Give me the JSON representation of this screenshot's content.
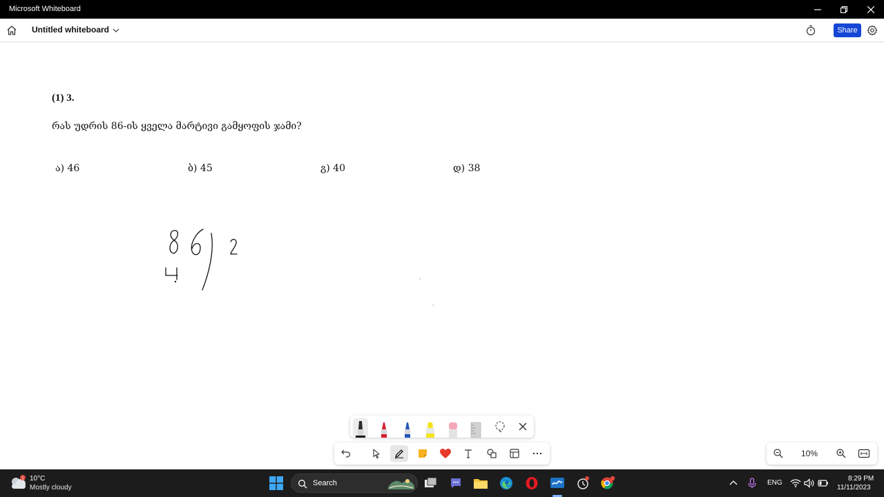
{
  "window": {
    "app_title": "Microsoft Whiteboard",
    "controls": [
      "minimize",
      "restore",
      "close"
    ]
  },
  "header": {
    "document_title": "Untitled whiteboard",
    "share_label": "Share",
    "icons": [
      "home-icon",
      "chevron-down-icon",
      "timer-icon",
      "gear-icon"
    ]
  },
  "canvas": {
    "question_number": "(1) 3.",
    "question_text": "რას უდრის 86-ის ყველა მარტივი გამყოფის ჯამი?",
    "options": [
      {
        "label": "ა) 46"
      },
      {
        "label": "ბ) 45"
      },
      {
        "label": "გ) 40"
      },
      {
        "label": "დ) 38"
      }
    ],
    "handwriting": "86 divided by 2, quotient starts with 4"
  },
  "pen_tray": {
    "pens": [
      {
        "name": "black-pen",
        "color": "#1a1a1a",
        "active": true
      },
      {
        "name": "red-pen",
        "color": "#d6202e"
      },
      {
        "name": "blue-pen",
        "color": "#2456b8"
      },
      {
        "name": "yellow-highlighter",
        "color": "#f3e41a"
      },
      {
        "name": "eraser",
        "color": "#f2a9b9"
      },
      {
        "name": "ruler",
        "color": "#c9c9c9"
      }
    ],
    "tools": [
      "lasso-icon",
      "close-icon"
    ]
  },
  "toolbar": {
    "tools": [
      "undo-icon",
      "select-icon",
      "pen-icon",
      "sticky-note-icon",
      "reaction-heart-icon",
      "text-icon",
      "shapes-icon",
      "templates-icon",
      "more-icon"
    ],
    "active_tool": "pen-icon"
  },
  "zoom": {
    "level": "10%"
  },
  "taskbar": {
    "weather_badge": "1",
    "weather_temp": "10°C",
    "weather_desc": "Mostly cloudy",
    "search_label": "Search",
    "language": "ENG",
    "time": "8:29 PM",
    "date": "11/11/2023",
    "colors": {
      "accent": "#0a66d8",
      "share": "#1546d6"
    }
  }
}
